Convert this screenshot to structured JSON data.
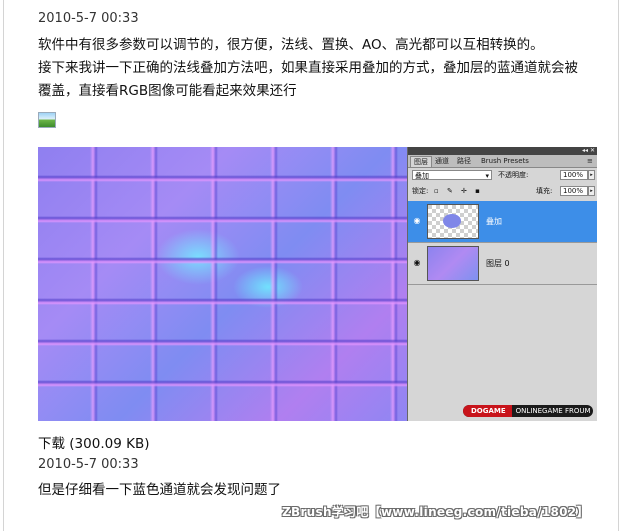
{
  "post1": {
    "timestamp": "2010-5-7 00:33",
    "line1": "软件中有很多参数可以调节的，很方便，法线、置换、AO、高光都可以互相转换的。",
    "line2": "接下来我讲一下正确的法线叠加方法吧，如果直接采用叠加的方式，叠加层的蓝通道就会被",
    "line3": "覆盖，直接看RGB图像可能看起来效果还行"
  },
  "image_icon": "image-placeholder-icon",
  "layers_panel": {
    "tabs": [
      "图层",
      "通道",
      "路径",
      "Brush Presets"
    ],
    "blend_mode": "叠加",
    "opacity_label": "不透明度:",
    "opacity_value": "100%",
    "lock_label": "锁定:",
    "fill_label": "填充:",
    "fill_value": "100%",
    "layers": [
      {
        "name": "叠加",
        "selected": true
      },
      {
        "name": "图层 0",
        "selected": false
      }
    ]
  },
  "watermark_badge": {
    "brand": "DOGAME",
    "text": "ONLINEGAME FROUM"
  },
  "download": "下载 (300.09 KB)",
  "post2": {
    "timestamp": "2010-5-7 00:33",
    "line1": "但是仔细看一下蓝色通道就会发现问题了"
  },
  "site_watermark": "ZBrush学习吧【www.lineeg.com/tieba/1802】",
  "colors": {
    "selected_layer": "#3d8ee8",
    "badge_red": "#c8141b"
  }
}
